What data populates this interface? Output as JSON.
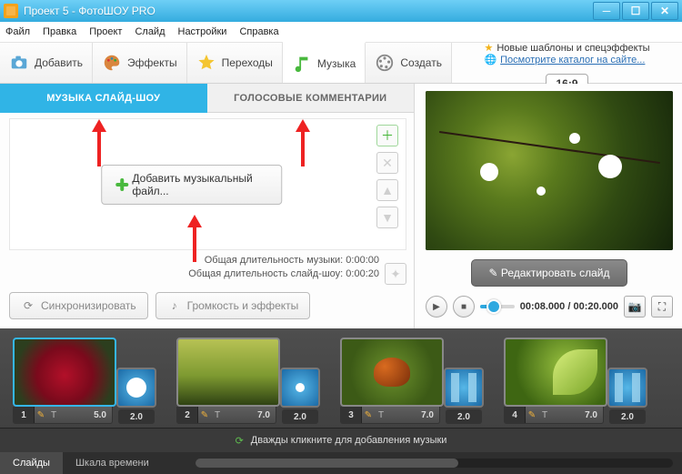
{
  "window": {
    "title": "Проект 5 - ФотоШОУ PRO"
  },
  "menu": {
    "file": "Файл",
    "edit": "Правка",
    "project": "Проект",
    "slide": "Слайд",
    "settings": "Настройки",
    "help": "Справка"
  },
  "toolbar": {
    "add": "Добавить",
    "effects": "Эффекты",
    "transitions": "Переходы",
    "music": "Музыка",
    "create": "Создать",
    "templates_line1": "Новые шаблоны и спецэффекты",
    "templates_link": "Посмотрите каталог на сайте...",
    "aspect": "16:9"
  },
  "music_panel": {
    "tab_music": "МУЗЫКА СЛАЙД-ШОУ",
    "tab_voice": "ГОЛОСОВЫЕ КОММЕНТАРИИ",
    "add_file": "Добавить музыкальный файл...",
    "dur_music_label": "Общая длительность музыки:",
    "dur_music_value": "0:00:00",
    "dur_show_label": "Общая длительность слайд-шоу:",
    "dur_show_value": "0:00:20",
    "sync": "Синхронизировать",
    "volume_fx": "Громкость и эффекты"
  },
  "preview": {
    "edit_slide": "Редактировать слайд",
    "time_current": "00:08.000",
    "time_total": "00:20.000"
  },
  "timeline": {
    "hint": "Дважды кликните для добавления музыки",
    "tab_slides": "Слайды",
    "tab_scale": "Шкала времени",
    "slides": [
      {
        "n": "1",
        "dur": "5.0",
        "trans": "2.0"
      },
      {
        "n": "2",
        "dur": "7.0",
        "trans": "2.0"
      },
      {
        "n": "3",
        "dur": "7.0",
        "trans": "2.0"
      },
      {
        "n": "4",
        "dur": "7.0",
        "trans": "2.0"
      }
    ]
  }
}
